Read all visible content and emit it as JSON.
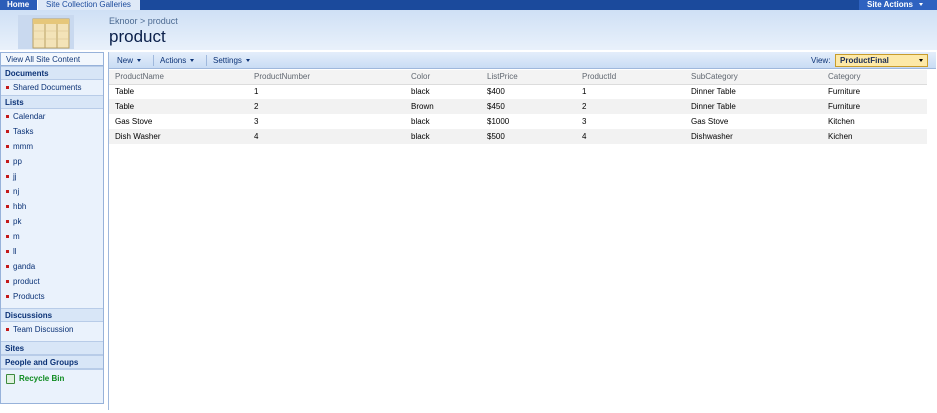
{
  "topbar": {
    "home": "Home",
    "galleries": "Site Collection Galleries",
    "site_actions": "Site Actions"
  },
  "header": {
    "breadcrumb": "Eknoor > product",
    "title": "product"
  },
  "leftnav": {
    "view_all": "View All Site Content",
    "documents_heading": "Documents",
    "documents": [
      "Shared Documents"
    ],
    "lists_heading": "Lists",
    "lists": [
      "Calendar",
      "Tasks",
      "mmm",
      "pp",
      "jj",
      "nj",
      "hbh",
      "pk",
      "m",
      "ll",
      "ganda",
      "product",
      "Products"
    ],
    "discussions_heading": "Discussions",
    "discussions": [
      "Team Discussion"
    ],
    "sites_heading": "Sites",
    "people_heading": "People and Groups",
    "recycle_bin": "Recycle Bin"
  },
  "toolbar": {
    "new": "New",
    "actions": "Actions",
    "settings": "Settings",
    "view_label": "View:",
    "view_value": "ProductFinal"
  },
  "table": {
    "columns": [
      "ProductName",
      "ProductNumber",
      "Color",
      "ListPrice",
      "ProductId",
      "SubCategory",
      "Category"
    ],
    "rows": [
      [
        "Table",
        "1",
        "black",
        "$400",
        "1",
        "Dinner Table",
        "Furniture"
      ],
      [
        "Table",
        "2",
        "Brown",
        "$450",
        "2",
        "Dinner Table",
        "Furniture"
      ],
      [
        "Gas Stove",
        "3",
        "black",
        "$1000",
        "3",
        "Gas Stove",
        "Kitchen"
      ],
      [
        "Dish Washer",
        "4",
        "black",
        "$500",
        "4",
        "Dishwasher",
        "Kichen"
      ]
    ]
  }
}
